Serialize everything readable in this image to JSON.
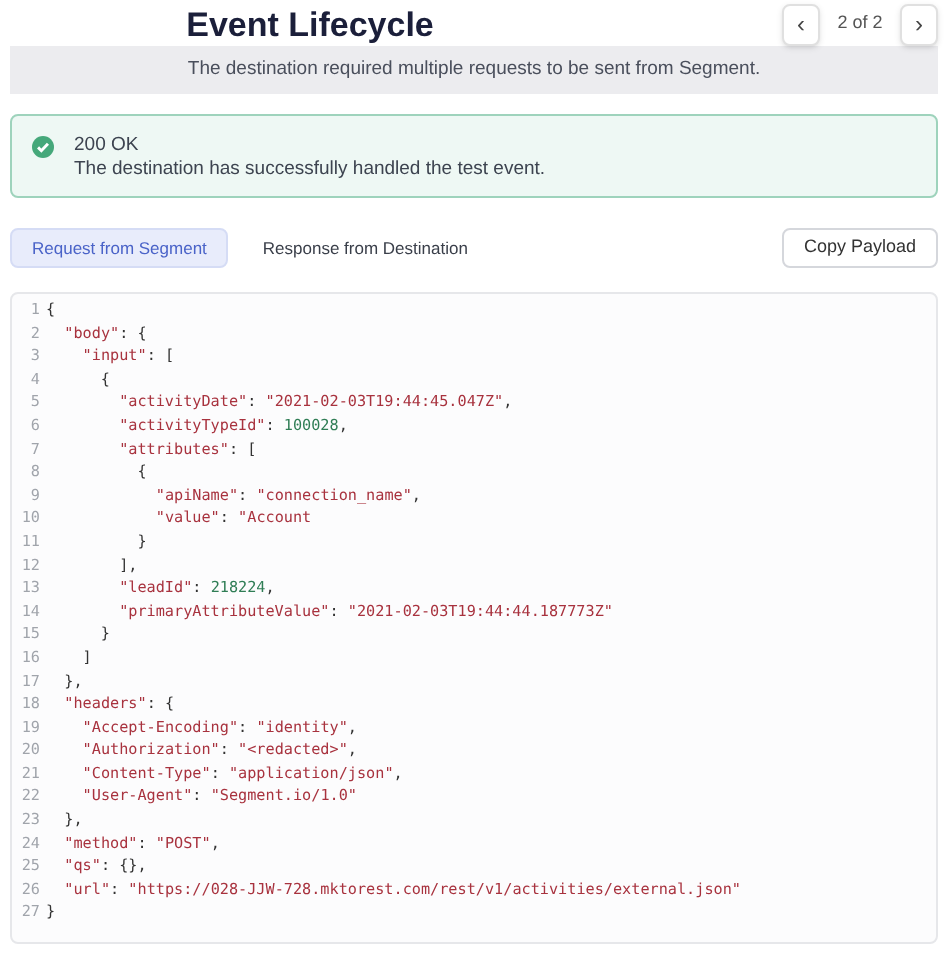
{
  "title": "Event Lifecycle",
  "pager": {
    "prev": "‹",
    "text": "2 of 2",
    "next": "›"
  },
  "banner": "The destination required multiple requests to be sent from Segment.",
  "status": {
    "kind": "success",
    "title": "200 OK",
    "message": "The destination has successfully handled the test event."
  },
  "tabs": [
    {
      "label": "Request from Segment",
      "selected": true
    },
    {
      "label": "Response from Destination",
      "selected": false
    }
  ],
  "copy_button": "Copy Payload",
  "code_lines": [
    {
      "number": "1",
      "code": "{"
    },
    {
      "number": "2",
      "code": "  \"body\": {"
    },
    {
      "number": "3",
      "code": "    \"input\": ["
    },
    {
      "number": "4",
      "code": "      {"
    },
    {
      "number": "5",
      "code": "        \"activityDate\": \"2021-02-03T19:44:45.047Z\","
    },
    {
      "number": "6",
      "code": "        \"activityTypeId\": 100028,"
    },
    {
      "number": "7",
      "code": "        \"attributes\": ["
    },
    {
      "number": "8",
      "code": "          {"
    },
    {
      "number": "9",
      "code": "            \"apiName\": \"connection_name\","
    },
    {
      "number": "10",
      "code": "            \"value\": \"Account"
    },
    {
      "number": "11",
      "code": "          }"
    },
    {
      "number": "12",
      "code": "        ],"
    },
    {
      "number": "13",
      "code": "        \"leadId\": 218224,"
    },
    {
      "number": "14",
      "code": "        \"primaryAttributeValue\": \"2021-02-03T19:44:44.187773Z\""
    },
    {
      "number": "15",
      "code": "      }"
    },
    {
      "number": "16",
      "code": "    ]"
    },
    {
      "number": "17",
      "code": "  },"
    },
    {
      "number": "18",
      "code": "  \"headers\": {"
    },
    {
      "number": "19",
      "code": "    \"Accept-Encoding\": \"identity\","
    },
    {
      "number": "20",
      "code": "    \"Authorization\": \"<redacted>\","
    },
    {
      "number": "21",
      "code": "    \"Content-Type\": \"application/json\","
    },
    {
      "number": "22",
      "code": "    \"User-Agent\": \"Segment.io/1.0\""
    },
    {
      "number": "23",
      "code": "  },"
    },
    {
      "number": "24",
      "code": "  \"method\": \"POST\","
    },
    {
      "number": "25",
      "code": "  \"qs\": {},"
    },
    {
      "number": "26",
      "code": "  \"url\": \"https://028-JJW-728.mktorest.com/rest/v1/activities/external.json\""
    },
    {
      "number": "27",
      "code": "}"
    }
  ]
}
